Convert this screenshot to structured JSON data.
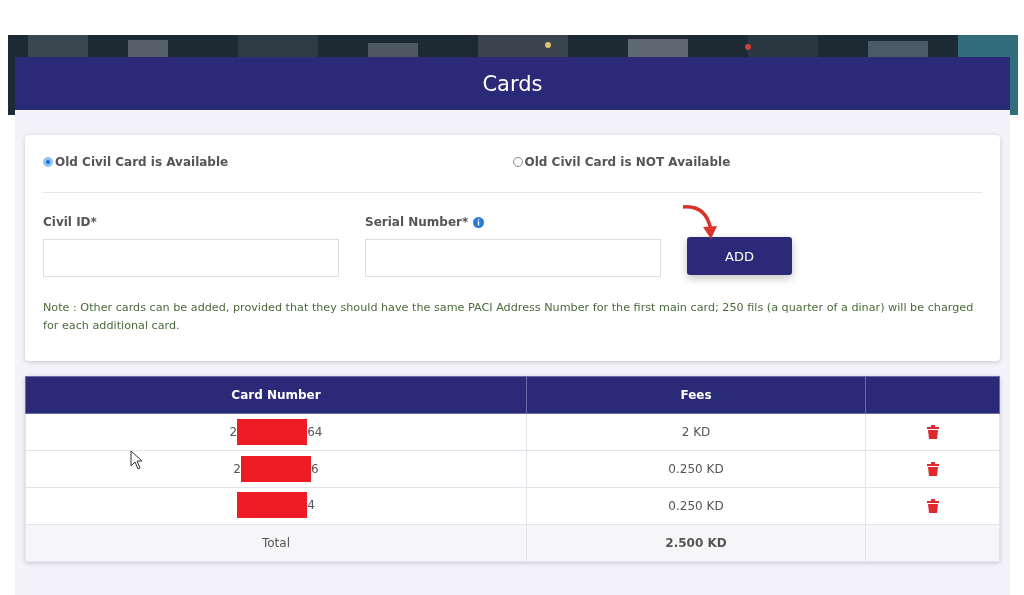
{
  "header": {
    "title": "Cards"
  },
  "options": [
    {
      "label": "Old Civil Card is Available",
      "selected": true
    },
    {
      "label": "Old Civil Card is NOT Available",
      "selected": false
    }
  ],
  "fields": [
    {
      "label": "Civil ID*",
      "info": false
    },
    {
      "label": "Serial Number*",
      "info": true
    }
  ],
  "add_button": "ADD",
  "note": "Note : Other cards can be added, provided that they should have the same PACI Address Number for the first main card; 250 fils (a quarter of a dinar) will be charged for each additional card.",
  "table": {
    "columns": [
      "Card Number",
      "Fees"
    ],
    "rows": [
      {
        "card_start": "2",
        "card_end": "64",
        "fees": "2 KD"
      },
      {
        "card_start": "2",
        "card_end": "6",
        "fees": "0.250 KD"
      },
      {
        "card_start": "",
        "card_end": "4",
        "fees": "0.250 KD"
      }
    ],
    "total": {
      "label": "Total",
      "fees": "2.500 KD"
    }
  }
}
